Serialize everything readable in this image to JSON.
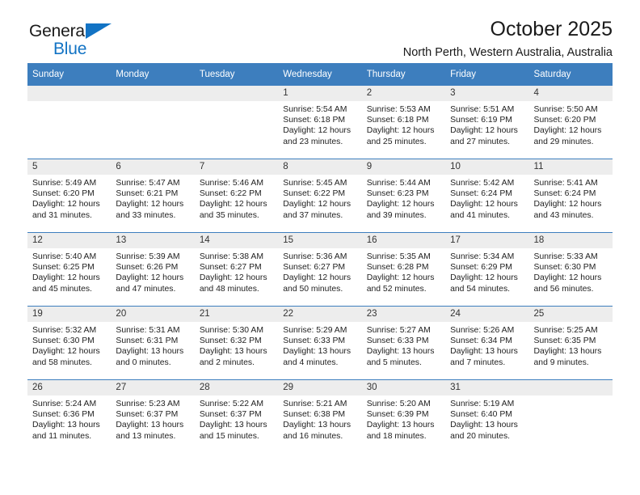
{
  "brand": {
    "line1": "General",
    "line2": "Blue",
    "triangle_color": "#1273c4"
  },
  "header": {
    "title": "October 2025",
    "subtitle": "North Perth, Western Australia, Australia",
    "accent_color": "#3d7ebe"
  },
  "calendar": {
    "weekday_headers": [
      "Sunday",
      "Monday",
      "Tuesday",
      "Wednesday",
      "Thursday",
      "Friday",
      "Saturday"
    ],
    "weeks": [
      [
        {
          "day": "",
          "blank": true
        },
        {
          "day": "",
          "blank": true
        },
        {
          "day": "",
          "blank": true
        },
        {
          "day": "1",
          "sunrise": "Sunrise: 5:54 AM",
          "sunset": "Sunset: 6:18 PM",
          "daylight1": "Daylight: 12 hours",
          "daylight2": "and 23 minutes."
        },
        {
          "day": "2",
          "sunrise": "Sunrise: 5:53 AM",
          "sunset": "Sunset: 6:18 PM",
          "daylight1": "Daylight: 12 hours",
          "daylight2": "and 25 minutes."
        },
        {
          "day": "3",
          "sunrise": "Sunrise: 5:51 AM",
          "sunset": "Sunset: 6:19 PM",
          "daylight1": "Daylight: 12 hours",
          "daylight2": "and 27 minutes."
        },
        {
          "day": "4",
          "sunrise": "Sunrise: 5:50 AM",
          "sunset": "Sunset: 6:20 PM",
          "daylight1": "Daylight: 12 hours",
          "daylight2": "and 29 minutes."
        }
      ],
      [
        {
          "day": "5",
          "sunrise": "Sunrise: 5:49 AM",
          "sunset": "Sunset: 6:20 PM",
          "daylight1": "Daylight: 12 hours",
          "daylight2": "and 31 minutes."
        },
        {
          "day": "6",
          "sunrise": "Sunrise: 5:47 AM",
          "sunset": "Sunset: 6:21 PM",
          "daylight1": "Daylight: 12 hours",
          "daylight2": "and 33 minutes."
        },
        {
          "day": "7",
          "sunrise": "Sunrise: 5:46 AM",
          "sunset": "Sunset: 6:22 PM",
          "daylight1": "Daylight: 12 hours",
          "daylight2": "and 35 minutes."
        },
        {
          "day": "8",
          "sunrise": "Sunrise: 5:45 AM",
          "sunset": "Sunset: 6:22 PM",
          "daylight1": "Daylight: 12 hours",
          "daylight2": "and 37 minutes."
        },
        {
          "day": "9",
          "sunrise": "Sunrise: 5:44 AM",
          "sunset": "Sunset: 6:23 PM",
          "daylight1": "Daylight: 12 hours",
          "daylight2": "and 39 minutes."
        },
        {
          "day": "10",
          "sunrise": "Sunrise: 5:42 AM",
          "sunset": "Sunset: 6:24 PM",
          "daylight1": "Daylight: 12 hours",
          "daylight2": "and 41 minutes."
        },
        {
          "day": "11",
          "sunrise": "Sunrise: 5:41 AM",
          "sunset": "Sunset: 6:24 PM",
          "daylight1": "Daylight: 12 hours",
          "daylight2": "and 43 minutes."
        }
      ],
      [
        {
          "day": "12",
          "sunrise": "Sunrise: 5:40 AM",
          "sunset": "Sunset: 6:25 PM",
          "daylight1": "Daylight: 12 hours",
          "daylight2": "and 45 minutes."
        },
        {
          "day": "13",
          "sunrise": "Sunrise: 5:39 AM",
          "sunset": "Sunset: 6:26 PM",
          "daylight1": "Daylight: 12 hours",
          "daylight2": "and 47 minutes."
        },
        {
          "day": "14",
          "sunrise": "Sunrise: 5:38 AM",
          "sunset": "Sunset: 6:27 PM",
          "daylight1": "Daylight: 12 hours",
          "daylight2": "and 48 minutes."
        },
        {
          "day": "15",
          "sunrise": "Sunrise: 5:36 AM",
          "sunset": "Sunset: 6:27 PM",
          "daylight1": "Daylight: 12 hours",
          "daylight2": "and 50 minutes."
        },
        {
          "day": "16",
          "sunrise": "Sunrise: 5:35 AM",
          "sunset": "Sunset: 6:28 PM",
          "daylight1": "Daylight: 12 hours",
          "daylight2": "and 52 minutes."
        },
        {
          "day": "17",
          "sunrise": "Sunrise: 5:34 AM",
          "sunset": "Sunset: 6:29 PM",
          "daylight1": "Daylight: 12 hours",
          "daylight2": "and 54 minutes."
        },
        {
          "day": "18",
          "sunrise": "Sunrise: 5:33 AM",
          "sunset": "Sunset: 6:30 PM",
          "daylight1": "Daylight: 12 hours",
          "daylight2": "and 56 minutes."
        }
      ],
      [
        {
          "day": "19",
          "sunrise": "Sunrise: 5:32 AM",
          "sunset": "Sunset: 6:30 PM",
          "daylight1": "Daylight: 12 hours",
          "daylight2": "and 58 minutes."
        },
        {
          "day": "20",
          "sunrise": "Sunrise: 5:31 AM",
          "sunset": "Sunset: 6:31 PM",
          "daylight1": "Daylight: 13 hours",
          "daylight2": "and 0 minutes."
        },
        {
          "day": "21",
          "sunrise": "Sunrise: 5:30 AM",
          "sunset": "Sunset: 6:32 PM",
          "daylight1": "Daylight: 13 hours",
          "daylight2": "and 2 minutes."
        },
        {
          "day": "22",
          "sunrise": "Sunrise: 5:29 AM",
          "sunset": "Sunset: 6:33 PM",
          "daylight1": "Daylight: 13 hours",
          "daylight2": "and 4 minutes."
        },
        {
          "day": "23",
          "sunrise": "Sunrise: 5:27 AM",
          "sunset": "Sunset: 6:33 PM",
          "daylight1": "Daylight: 13 hours",
          "daylight2": "and 5 minutes."
        },
        {
          "day": "24",
          "sunrise": "Sunrise: 5:26 AM",
          "sunset": "Sunset: 6:34 PM",
          "daylight1": "Daylight: 13 hours",
          "daylight2": "and 7 minutes."
        },
        {
          "day": "25",
          "sunrise": "Sunrise: 5:25 AM",
          "sunset": "Sunset: 6:35 PM",
          "daylight1": "Daylight: 13 hours",
          "daylight2": "and 9 minutes."
        }
      ],
      [
        {
          "day": "26",
          "sunrise": "Sunrise: 5:24 AM",
          "sunset": "Sunset: 6:36 PM",
          "daylight1": "Daylight: 13 hours",
          "daylight2": "and 11 minutes."
        },
        {
          "day": "27",
          "sunrise": "Sunrise: 5:23 AM",
          "sunset": "Sunset: 6:37 PM",
          "daylight1": "Daylight: 13 hours",
          "daylight2": "and 13 minutes."
        },
        {
          "day": "28",
          "sunrise": "Sunrise: 5:22 AM",
          "sunset": "Sunset: 6:37 PM",
          "daylight1": "Daylight: 13 hours",
          "daylight2": "and 15 minutes."
        },
        {
          "day": "29",
          "sunrise": "Sunrise: 5:21 AM",
          "sunset": "Sunset: 6:38 PM",
          "daylight1": "Daylight: 13 hours",
          "daylight2": "and 16 minutes."
        },
        {
          "day": "30",
          "sunrise": "Sunrise: 5:20 AM",
          "sunset": "Sunset: 6:39 PM",
          "daylight1": "Daylight: 13 hours",
          "daylight2": "and 18 minutes."
        },
        {
          "day": "31",
          "sunrise": "Sunrise: 5:19 AM",
          "sunset": "Sunset: 6:40 PM",
          "daylight1": "Daylight: 13 hours",
          "daylight2": "and 20 minutes."
        },
        {
          "day": "",
          "blank": true
        }
      ]
    ]
  }
}
